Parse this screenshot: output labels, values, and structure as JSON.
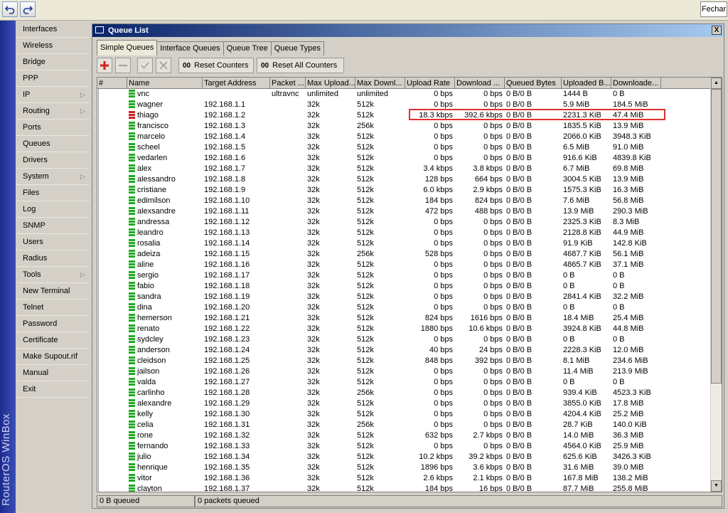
{
  "topbar": {
    "close_label": "Fechar"
  },
  "brand": {
    "text": "RouterOS WinBox"
  },
  "menu": [
    {
      "label": "Interfaces",
      "submenu": false
    },
    {
      "label": "Wireless",
      "submenu": false
    },
    {
      "label": "Bridge",
      "submenu": false
    },
    {
      "label": "PPP",
      "submenu": false
    },
    {
      "label": "IP",
      "submenu": true
    },
    {
      "label": "Routing",
      "submenu": true
    },
    {
      "label": "Ports",
      "submenu": false
    },
    {
      "label": "Queues",
      "submenu": false
    },
    {
      "label": "Drivers",
      "submenu": false
    },
    {
      "label": "System",
      "submenu": true
    },
    {
      "label": "Files",
      "submenu": false
    },
    {
      "label": "Log",
      "submenu": false
    },
    {
      "label": "SNMP",
      "submenu": false
    },
    {
      "label": "Users",
      "submenu": false
    },
    {
      "label": "Radius",
      "submenu": false
    },
    {
      "label": "Tools",
      "submenu": true
    },
    {
      "label": "New Terminal",
      "submenu": false
    },
    {
      "label": "Telnet",
      "submenu": false
    },
    {
      "label": "Password",
      "submenu": false
    },
    {
      "label": "Certificate",
      "submenu": false
    },
    {
      "label": "Make Supout.rif",
      "submenu": false
    },
    {
      "label": "Manual",
      "submenu": false
    },
    {
      "label": "Exit",
      "submenu": false
    }
  ],
  "window": {
    "title": "Queue List",
    "close_label": "X",
    "tabs": [
      "Simple Queues",
      "Interface Queues",
      "Queue Tree",
      "Queue Types"
    ],
    "active_tab": "Simple Queues",
    "toolbar": {
      "reset_counters": "Reset Counters",
      "reset_all_counters": "Reset All Counters",
      "counter_glyph": "00"
    }
  },
  "table": {
    "columns": [
      "#",
      "Name",
      "Target Address",
      "Packet ...",
      "Max Upload...",
      "Max Downl...",
      "Upload Rate",
      "Download ...",
      "Queued Bytes",
      "Uploaded B...",
      "Downloade..."
    ],
    "rows": [
      {
        "name": "vnc",
        "target": "",
        "packet": "ultravnc",
        "max_up": "unlimited",
        "max_down": "unlimited",
        "up_rate": "0 bps",
        "down_rate": "0 bps",
        "queued": "0 B/0 B",
        "uploaded": "1444 B",
        "downloaded": "0 B",
        "icon": "green"
      },
      {
        "name": "wagner",
        "target": "192.168.1.1",
        "packet": "",
        "max_up": "32k",
        "max_down": "512k",
        "up_rate": "0 bps",
        "down_rate": "0 bps",
        "queued": "0 B/0 B",
        "uploaded": "5.9 MiB",
        "downloaded": "184.5 MiB",
        "icon": "green"
      },
      {
        "name": "thiago",
        "target": "192.168.1.2",
        "packet": "",
        "max_up": "32k",
        "max_down": "512k",
        "up_rate": "18.3 kbps",
        "down_rate": "392.6 kbps",
        "queued": "0 B/0 B",
        "uploaded": "2231.3 KiB",
        "downloaded": "47.4 MiB",
        "icon": "red"
      },
      {
        "name": "francisco",
        "target": "192.168.1.3",
        "packet": "",
        "max_up": "32k",
        "max_down": "256k",
        "up_rate": "0 bps",
        "down_rate": "0 bps",
        "queued": "0 B/0 B",
        "uploaded": "1835.5 KiB",
        "downloaded": "13.9 MiB",
        "icon": "green"
      },
      {
        "name": "marcelo",
        "target": "192.168.1.4",
        "packet": "",
        "max_up": "32k",
        "max_down": "512k",
        "up_rate": "0 bps",
        "down_rate": "0 bps",
        "queued": "0 B/0 B",
        "uploaded": "2066.0 KiB",
        "downloaded": "3948.3 KiB",
        "icon": "green"
      },
      {
        "name": "scheel",
        "target": "192.168.1.5",
        "packet": "",
        "max_up": "32k",
        "max_down": "512k",
        "up_rate": "0 bps",
        "down_rate": "0 bps",
        "queued": "0 B/0 B",
        "uploaded": "6.5 MiB",
        "downloaded": "91.0 MiB",
        "icon": "green"
      },
      {
        "name": "vedarlen",
        "target": "192.168.1.6",
        "packet": "",
        "max_up": "32k",
        "max_down": "512k",
        "up_rate": "0 bps",
        "down_rate": "0 bps",
        "queued": "0 B/0 B",
        "uploaded": "916.6 KiB",
        "downloaded": "4839.8 KiB",
        "icon": "green"
      },
      {
        "name": "alex",
        "target": "192.168.1.7",
        "packet": "",
        "max_up": "32k",
        "max_down": "512k",
        "up_rate": "3.4 kbps",
        "down_rate": "3.8 kbps",
        "queued": "0 B/0 B",
        "uploaded": "6.7 MiB",
        "downloaded": "69.8 MiB",
        "icon": "green"
      },
      {
        "name": "alessandro",
        "target": "192.168.1.8",
        "packet": "",
        "max_up": "32k",
        "max_down": "512k",
        "up_rate": "128 bps",
        "down_rate": "664 bps",
        "queued": "0 B/0 B",
        "uploaded": "3004.5 KiB",
        "downloaded": "13.9 MiB",
        "icon": "green"
      },
      {
        "name": "cristiane",
        "target": "192.168.1.9",
        "packet": "",
        "max_up": "32k",
        "max_down": "512k",
        "up_rate": "6.0 kbps",
        "down_rate": "2.9 kbps",
        "queued": "0 B/0 B",
        "uploaded": "1575.3 KiB",
        "downloaded": "16.3 MiB",
        "icon": "green"
      },
      {
        "name": "edimilson",
        "target": "192.168.1.10",
        "packet": "",
        "max_up": "32k",
        "max_down": "512k",
        "up_rate": "184 bps",
        "down_rate": "824 bps",
        "queued": "0 B/0 B",
        "uploaded": "7.6 MiB",
        "downloaded": "56.8 MiB",
        "icon": "green"
      },
      {
        "name": "alexsandre",
        "target": "192.168.1.11",
        "packet": "",
        "max_up": "32k",
        "max_down": "512k",
        "up_rate": "472 bps",
        "down_rate": "488 bps",
        "queued": "0 B/0 B",
        "uploaded": "13.9 MiB",
        "downloaded": "290.3 MiB",
        "icon": "green"
      },
      {
        "name": "andressa",
        "target": "192.168.1.12",
        "packet": "",
        "max_up": "32k",
        "max_down": "512k",
        "up_rate": "0 bps",
        "down_rate": "0 bps",
        "queued": "0 B/0 B",
        "uploaded": "2325.3 KiB",
        "downloaded": "8.3 MiB",
        "icon": "green"
      },
      {
        "name": "leandro",
        "target": "192.168.1.13",
        "packet": "",
        "max_up": "32k",
        "max_down": "512k",
        "up_rate": "0 bps",
        "down_rate": "0 bps",
        "queued": "0 B/0 B",
        "uploaded": "2128.8 KiB",
        "downloaded": "44.9 MiB",
        "icon": "green"
      },
      {
        "name": "rosalia",
        "target": "192.168.1.14",
        "packet": "",
        "max_up": "32k",
        "max_down": "512k",
        "up_rate": "0 bps",
        "down_rate": "0 bps",
        "queued": "0 B/0 B",
        "uploaded": "91.9 KiB",
        "downloaded": "142.8 KiB",
        "icon": "green"
      },
      {
        "name": "adeiza",
        "target": "192.168.1.15",
        "packet": "",
        "max_up": "32k",
        "max_down": "256k",
        "up_rate": "528 bps",
        "down_rate": "0 bps",
        "queued": "0 B/0 B",
        "uploaded": "4687.7 KiB",
        "downloaded": "56.1 MiB",
        "icon": "green"
      },
      {
        "name": "aline",
        "target": "192.168.1.16",
        "packet": "",
        "max_up": "32k",
        "max_down": "512k",
        "up_rate": "0 bps",
        "down_rate": "0 bps",
        "queued": "0 B/0 B",
        "uploaded": "4865.7 KiB",
        "downloaded": "37.1 MiB",
        "icon": "green"
      },
      {
        "name": "sergio",
        "target": "192.168.1.17",
        "packet": "",
        "max_up": "32k",
        "max_down": "512k",
        "up_rate": "0 bps",
        "down_rate": "0 bps",
        "queued": "0 B/0 B",
        "uploaded": "0 B",
        "downloaded": "0 B",
        "icon": "green"
      },
      {
        "name": "fabio",
        "target": "192.168.1.18",
        "packet": "",
        "max_up": "32k",
        "max_down": "512k",
        "up_rate": "0 bps",
        "down_rate": "0 bps",
        "queued": "0 B/0 B",
        "uploaded": "0 B",
        "downloaded": "0 B",
        "icon": "green"
      },
      {
        "name": "sandra",
        "target": "192.168.1.19",
        "packet": "",
        "max_up": "32k",
        "max_down": "512k",
        "up_rate": "0 bps",
        "down_rate": "0 bps",
        "queued": "0 B/0 B",
        "uploaded": "2841.4 KiB",
        "downloaded": "32.2 MiB",
        "icon": "green"
      },
      {
        "name": "dina",
        "target": "192.168.1.20",
        "packet": "",
        "max_up": "32k",
        "max_down": "512k",
        "up_rate": "0 bps",
        "down_rate": "0 bps",
        "queued": "0 B/0 B",
        "uploaded": "0 B",
        "downloaded": "0 B",
        "icon": "green"
      },
      {
        "name": "hemerson",
        "target": "192.168.1.21",
        "packet": "",
        "max_up": "32k",
        "max_down": "512k",
        "up_rate": "824 bps",
        "down_rate": "1616 bps",
        "queued": "0 B/0 B",
        "uploaded": "18.4 MiB",
        "downloaded": "25.4 MiB",
        "icon": "green"
      },
      {
        "name": "renato",
        "target": "192.168.1.22",
        "packet": "",
        "max_up": "32k",
        "max_down": "512k",
        "up_rate": "1880 bps",
        "down_rate": "10.6 kbps",
        "queued": "0 B/0 B",
        "uploaded": "3924.8 KiB",
        "downloaded": "44.8 MiB",
        "icon": "green"
      },
      {
        "name": "sydcley",
        "target": "192.168.1.23",
        "packet": "",
        "max_up": "32k",
        "max_down": "512k",
        "up_rate": "0 bps",
        "down_rate": "0 bps",
        "queued": "0 B/0 B",
        "uploaded": "0 B",
        "downloaded": "0 B",
        "icon": "green"
      },
      {
        "name": "anderson",
        "target": "192.168.1.24",
        "packet": "",
        "max_up": "32k",
        "max_down": "512k",
        "up_rate": "40 bps",
        "down_rate": "24 bps",
        "queued": "0 B/0 B",
        "uploaded": "2228.3 KiB",
        "downloaded": "12.0 MiB",
        "icon": "green"
      },
      {
        "name": "cleidson",
        "target": "192.168.1.25",
        "packet": "",
        "max_up": "32k",
        "max_down": "512k",
        "up_rate": "848 bps",
        "down_rate": "392 bps",
        "queued": "0 B/0 B",
        "uploaded": "8.1 MiB",
        "downloaded": "234.6 MiB",
        "icon": "green"
      },
      {
        "name": "jailson",
        "target": "192.168.1.26",
        "packet": "",
        "max_up": "32k",
        "max_down": "512k",
        "up_rate": "0 bps",
        "down_rate": "0 bps",
        "queued": "0 B/0 B",
        "uploaded": "11.4 MiB",
        "downloaded": "213.9 MiB",
        "icon": "green"
      },
      {
        "name": "valda",
        "target": "192.168.1.27",
        "packet": "",
        "max_up": "32k",
        "max_down": "512k",
        "up_rate": "0 bps",
        "down_rate": "0 bps",
        "queued": "0 B/0 B",
        "uploaded": "0 B",
        "downloaded": "0 B",
        "icon": "green"
      },
      {
        "name": "carlinho",
        "target": "192.168.1.28",
        "packet": "",
        "max_up": "32k",
        "max_down": "256k",
        "up_rate": "0 bps",
        "down_rate": "0 bps",
        "queued": "0 B/0 B",
        "uploaded": "939.4 KiB",
        "downloaded": "4523.3 KiB",
        "icon": "green"
      },
      {
        "name": "alexandre",
        "target": "192.168.1.29",
        "packet": "",
        "max_up": "32k",
        "max_down": "512k",
        "up_rate": "0 bps",
        "down_rate": "0 bps",
        "queued": "0 B/0 B",
        "uploaded": "3855.0 KiB",
        "downloaded": "17.8 MiB",
        "icon": "green"
      },
      {
        "name": "kelly",
        "target": "192.168.1.30",
        "packet": "",
        "max_up": "32k",
        "max_down": "512k",
        "up_rate": "0 bps",
        "down_rate": "0 bps",
        "queued": "0 B/0 B",
        "uploaded": "4204.4 KiB",
        "downloaded": "25.2 MiB",
        "icon": "green"
      },
      {
        "name": "celia",
        "target": "192.168.1.31",
        "packet": "",
        "max_up": "32k",
        "max_down": "256k",
        "up_rate": "0 bps",
        "down_rate": "0 bps",
        "queued": "0 B/0 B",
        "uploaded": "28.7 KiB",
        "downloaded": "140.0 KiB",
        "icon": "green"
      },
      {
        "name": "rone",
        "target": "192.168.1.32",
        "packet": "",
        "max_up": "32k",
        "max_down": "512k",
        "up_rate": "632 bps",
        "down_rate": "2.7 kbps",
        "queued": "0 B/0 B",
        "uploaded": "14.0 MiB",
        "downloaded": "36.3 MiB",
        "icon": "green"
      },
      {
        "name": "fernando",
        "target": "192.168.1.33",
        "packet": "",
        "max_up": "32k",
        "max_down": "512k",
        "up_rate": "0 bps",
        "down_rate": "0 bps",
        "queued": "0 B/0 B",
        "uploaded": "4564.0 KiB",
        "downloaded": "25.9 MiB",
        "icon": "green"
      },
      {
        "name": "julio",
        "target": "192.168.1.34",
        "packet": "",
        "max_up": "32k",
        "max_down": "512k",
        "up_rate": "10.2 kbps",
        "down_rate": "39.2 kbps",
        "queued": "0 B/0 B",
        "uploaded": "625.6 KiB",
        "downloaded": "3426.3 KiB",
        "icon": "green"
      },
      {
        "name": "henrique",
        "target": "192.168.1.35",
        "packet": "",
        "max_up": "32k",
        "max_down": "512k",
        "up_rate": "1896 bps",
        "down_rate": "3.6 kbps",
        "queued": "0 B/0 B",
        "uploaded": "31.6 MiB",
        "downloaded": "39.0 MiB",
        "icon": "green"
      },
      {
        "name": "vitor",
        "target": "192.168.1.36",
        "packet": "",
        "max_up": "32k",
        "max_down": "512k",
        "up_rate": "2.6 kbps",
        "down_rate": "2.1 kbps",
        "queued": "0 B/0 B",
        "uploaded": "167.8 MiB",
        "downloaded": "138.2 MiB",
        "icon": "green"
      },
      {
        "name": "clayton",
        "target": "192.168.1.37",
        "packet": "",
        "max_up": "32k",
        "max_down": "512k",
        "up_rate": "184 bps",
        "down_rate": "16 bps",
        "queued": "0 B/0 B",
        "uploaded": "87.7 MiB",
        "downloaded": "255.8 MiB",
        "icon": "green"
      }
    ]
  },
  "status": {
    "queued_bytes": "0 B queued",
    "queued_packets": "0 packets queued"
  },
  "colors": {
    "icon_green": "#22aa22",
    "icon_red": "#cc2222",
    "highlight": "#e0302a",
    "title_start": "#0a246a",
    "title_end": "#a6caf0"
  },
  "icons": {
    "undo": "undo-arrow-icon",
    "redo": "redo-arrow-icon",
    "add": "plus-icon",
    "remove": "minus-icon",
    "enable": "check-icon",
    "disable": "x-icon"
  }
}
